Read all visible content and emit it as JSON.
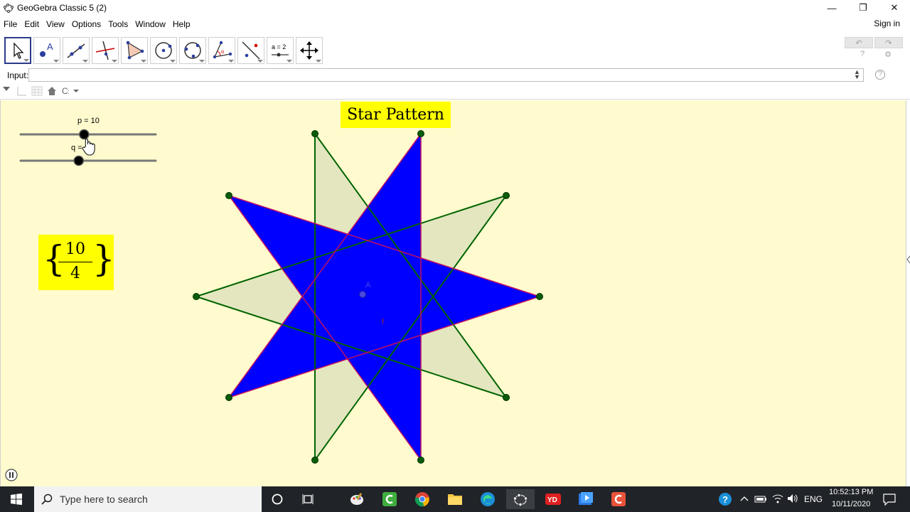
{
  "window": {
    "title": "GeoGebra Classic 5 (2)",
    "minimize_glyph": "—",
    "maximize_glyph": "❐",
    "close_glyph": "✕"
  },
  "menu": {
    "items": [
      "File",
      "Edit",
      "View",
      "Options",
      "Tools",
      "Window",
      "Help"
    ],
    "sign_in": "Sign in"
  },
  "toolbar": {
    "tools": [
      "move-tool",
      "point-tool",
      "line-tool",
      "perpendicular-tool",
      "polygon-tool",
      "circle-tool",
      "conic-tool",
      "angle-tool",
      "reflect-tool",
      "slider-tool",
      "move-view-tool"
    ],
    "slider_tool_label": "a = 2",
    "undo_glyph": "↶",
    "redo_glyph": "↷",
    "help_glyph": "?",
    "settings_glyph": "⚙"
  },
  "input_bar": {
    "label": "Input:",
    "value": "",
    "help_glyph": "?"
  },
  "graphics": {
    "title": "Star Pattern",
    "fraction": {
      "numerator": "10",
      "denominator": "4"
    },
    "slider_p": {
      "label": "p = 10",
      "fraction": 0.47
    },
    "slider_q": {
      "label": "q =",
      "fraction": 0.43
    },
    "point_label": "A",
    "function_label": "f",
    "colors": {
      "background": "#fffbce",
      "label_bg": "#ffff00",
      "star_fill": "#0000ff",
      "star_edge": "#c01060",
      "outer_fill": "#e3e6bf",
      "outer_edge": "#006400",
      "vertex": "#0a5c0a",
      "point_a": "#4a4ae0"
    }
  },
  "taskbar": {
    "search_placeholder": "Type here to search",
    "language": "ENG",
    "time": "10:52:13 PM",
    "date": "10/11/2020"
  }
}
